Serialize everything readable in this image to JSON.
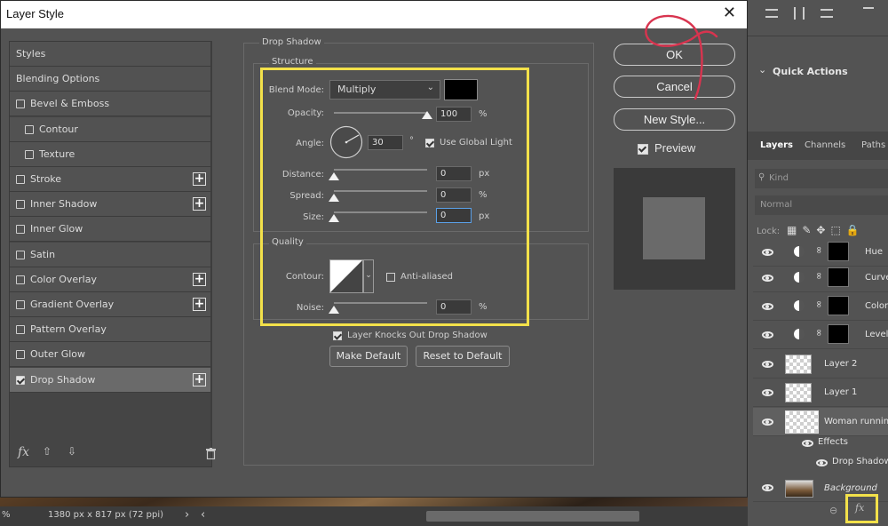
{
  "dialog": {
    "title": "Layer Style",
    "close_glyph": "✕"
  },
  "styles_list": [
    {
      "label": "Styles",
      "checkbox": false,
      "plus": false,
      "indent": 0
    },
    {
      "label": "Blending Options",
      "checkbox": false,
      "plus": false,
      "indent": 0
    },
    {
      "label": "Bevel & Emboss",
      "checkbox": true,
      "checked": false,
      "plus": false,
      "indent": 0
    },
    {
      "label": "Contour",
      "checkbox": true,
      "checked": false,
      "plus": false,
      "indent": 1
    },
    {
      "label": "Texture",
      "checkbox": true,
      "checked": false,
      "plus": false,
      "indent": 1
    },
    {
      "label": "Stroke",
      "checkbox": true,
      "checked": false,
      "plus": true,
      "indent": 0
    },
    {
      "label": "Inner Shadow",
      "checkbox": true,
      "checked": false,
      "plus": true,
      "indent": 0
    },
    {
      "label": "Inner Glow",
      "checkbox": true,
      "checked": false,
      "plus": false,
      "indent": 0
    },
    {
      "label": "Satin",
      "checkbox": true,
      "checked": false,
      "plus": false,
      "indent": 0
    },
    {
      "label": "Color Overlay",
      "checkbox": true,
      "checked": false,
      "plus": true,
      "indent": 0
    },
    {
      "label": "Gradient Overlay",
      "checkbox": true,
      "checked": false,
      "plus": true,
      "indent": 0
    },
    {
      "label": "Pattern Overlay",
      "checkbox": true,
      "checked": false,
      "plus": false,
      "indent": 0
    },
    {
      "label": "Outer Glow",
      "checkbox": true,
      "checked": false,
      "plus": false,
      "indent": 0
    },
    {
      "label": "Drop Shadow",
      "checkbox": true,
      "checked": true,
      "plus": true,
      "indent": 0,
      "selected": true
    }
  ],
  "list_footer": {
    "fx": "fx",
    "up": "⇧",
    "down": "⇩",
    "trash": "🗑"
  },
  "drop_shadow": {
    "section_title": "Drop Shadow",
    "structure_title": "Structure",
    "blend_mode_label": "Blend Mode:",
    "blend_mode_value": "Multiply",
    "shadow_color": "#000000",
    "opacity_label": "Opacity:",
    "opacity_value": "100",
    "opacity_unit": "%",
    "opacity_level": 1.0,
    "angle_label": "Angle:",
    "angle_value": "30",
    "angle_unit": "°",
    "use_global_light_label": "Use Global Light",
    "use_global_light": true,
    "distance_label": "Distance:",
    "distance_value": "0",
    "distance_unit": "px",
    "spread_label": "Spread:",
    "spread_value": "0",
    "spread_unit": "%",
    "size_label": "Size:",
    "size_value": "0",
    "size_unit": "px",
    "quality_title": "Quality",
    "contour_label": "Contour:",
    "anti_aliased_label": "Anti-aliased",
    "anti_aliased": false,
    "noise_label": "Noise:",
    "noise_value": "0",
    "noise_unit": "%",
    "knocks_out_label": "Layer Knocks Out Drop Shadow",
    "knocks_out": true,
    "make_default_label": "Make Default",
    "reset_default_label": "Reset to Default"
  },
  "actions": {
    "ok_label": "OK",
    "cancel_label": "Cancel",
    "new_style_label": "New Style...",
    "preview_label": "Preview",
    "preview": true
  },
  "colors": {
    "highlight_yellow": "#f3e14a",
    "annotation_red": "#d8344f"
  },
  "status": {
    "zoom": "%",
    "doc_info": "1380 px x 817 px (72 ppi)",
    "arrow_right": "›",
    "arrow_left": "‹"
  },
  "right_panel": {
    "quick_actions": "Quick Actions",
    "tabs": [
      "Layers",
      "Channels",
      "Paths"
    ],
    "kind_placeholder": "Kind",
    "blend": "Normal",
    "lock_label": "Lock:",
    "layers": [
      {
        "name": "Hue",
        "type": "adjust"
      },
      {
        "name": "Curves",
        "type": "adjust"
      },
      {
        "name": "Color",
        "type": "adjust"
      },
      {
        "name": "Levels",
        "type": "adjust"
      },
      {
        "name": "Layer 2",
        "type": "transparent"
      },
      {
        "name": "Layer 1",
        "type": "transparent"
      },
      {
        "name": "Woman running",
        "type": "image"
      }
    ],
    "effects_label": "Effects",
    "effect_item": "Drop Shadow",
    "background_label": "Background",
    "fx_label": "fx"
  }
}
